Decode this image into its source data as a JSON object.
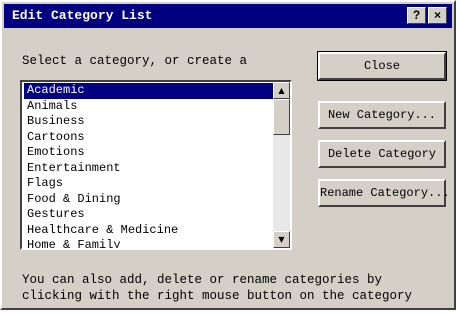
{
  "window": {
    "title": "Edit Category List",
    "help_glyph": "?",
    "close_glyph": "×"
  },
  "prompt": "Select a category, or create a",
  "categories": [
    {
      "label": "Academic",
      "selected": true
    },
    {
      "label": "Animals",
      "selected": false
    },
    {
      "label": "Business",
      "selected": false
    },
    {
      "label": "Cartoons",
      "selected": false
    },
    {
      "label": "Emotions",
      "selected": false
    },
    {
      "label": "Entertainment",
      "selected": false
    },
    {
      "label": "Flags",
      "selected": false
    },
    {
      "label": "Food & Dining",
      "selected": false
    },
    {
      "label": "Gestures",
      "selected": false
    },
    {
      "label": "Healthcare & Medicine",
      "selected": false
    },
    {
      "label": "Home & Family",
      "selected": false
    }
  ],
  "scrollbar": {
    "up_glyph": "▲",
    "down_glyph": "▼"
  },
  "buttons": {
    "close": "Close",
    "new_category": "New Category...",
    "delete_category": "Delete Category",
    "rename_category": "Rename Category..."
  },
  "hint": {
    "line1": "You can also add, delete or rename categories by",
    "line2": "clicking with the right mouse button on the category"
  }
}
